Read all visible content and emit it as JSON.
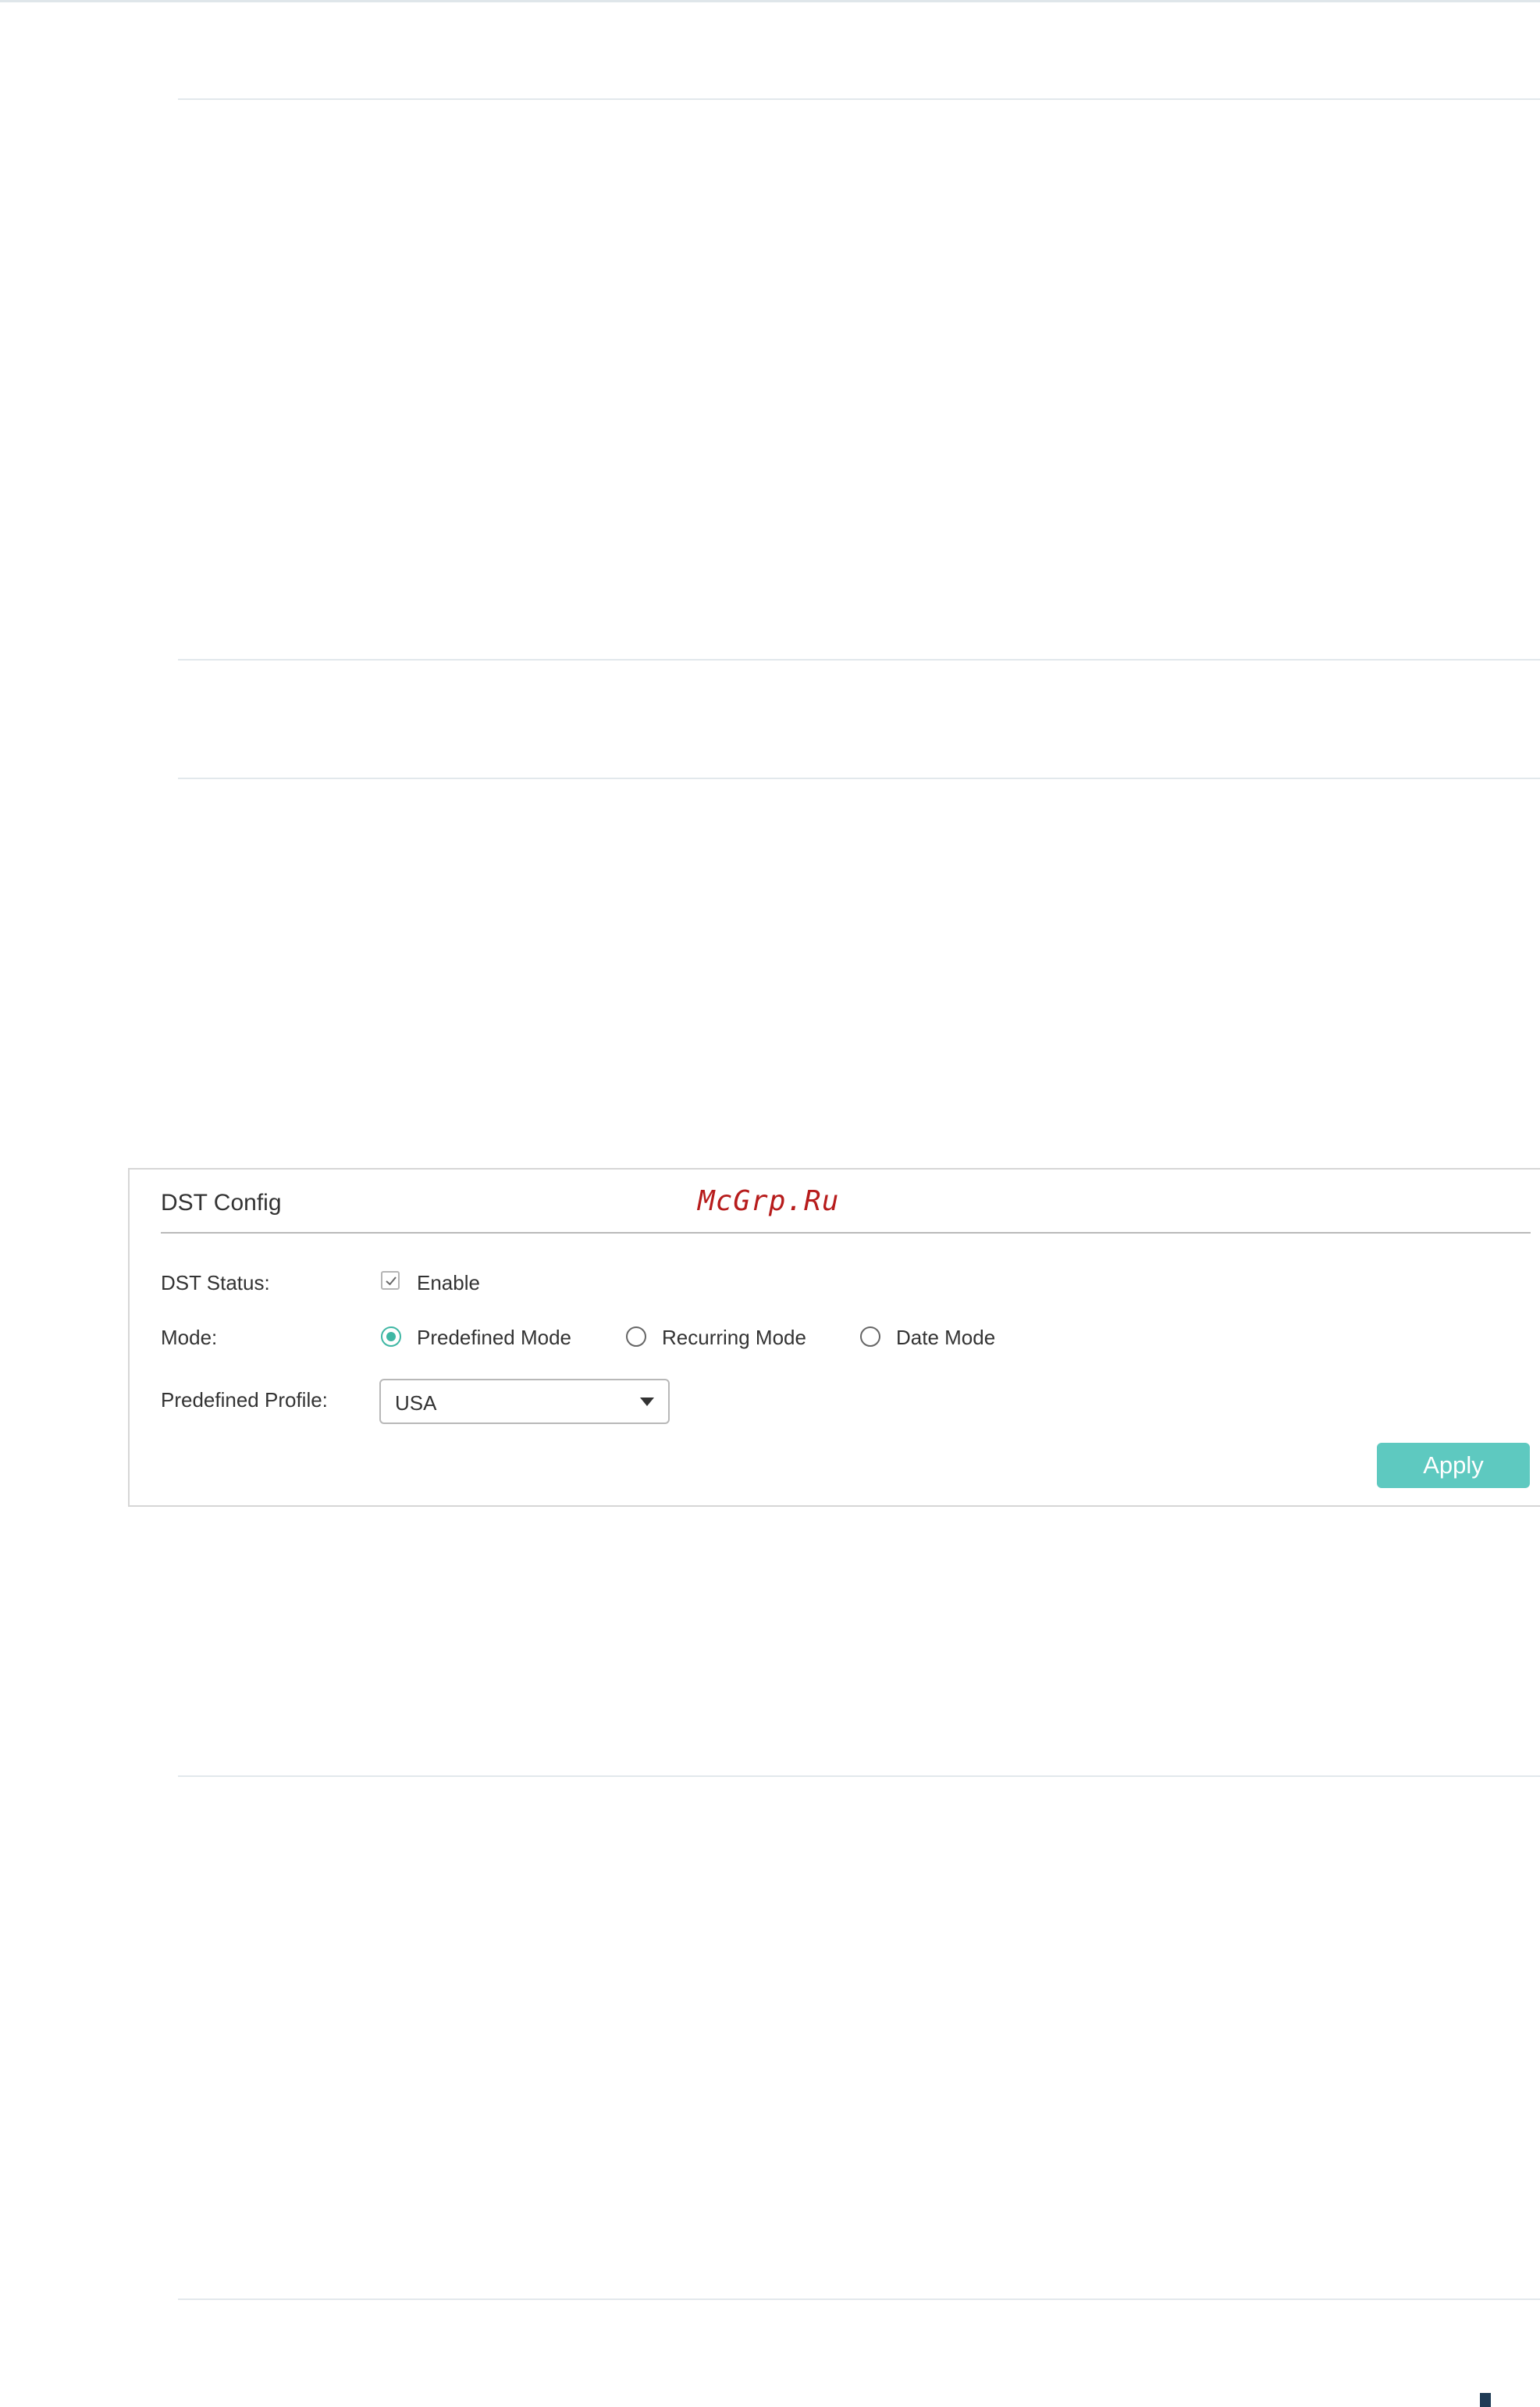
{
  "panel": {
    "title": "DST Config",
    "watermark": "McGrp.Ru",
    "dst_status": {
      "label": "DST Status:",
      "checkbox_label": "Enable",
      "checked": true
    },
    "mode": {
      "label": "Mode:",
      "options": [
        {
          "label": "Predefined Mode",
          "selected": true
        },
        {
          "label": "Recurring Mode",
          "selected": false
        },
        {
          "label": "Date Mode",
          "selected": false
        }
      ]
    },
    "predefined_profile": {
      "label": "Predefined Profile:",
      "value": "USA"
    },
    "apply_label": "Apply"
  },
  "colors": {
    "accent": "#3fb7a4",
    "button": "#5ec9c0",
    "watermark": "#b71c1c"
  },
  "icons": {
    "check": "check-icon",
    "dropdown": "caret-down-icon"
  }
}
